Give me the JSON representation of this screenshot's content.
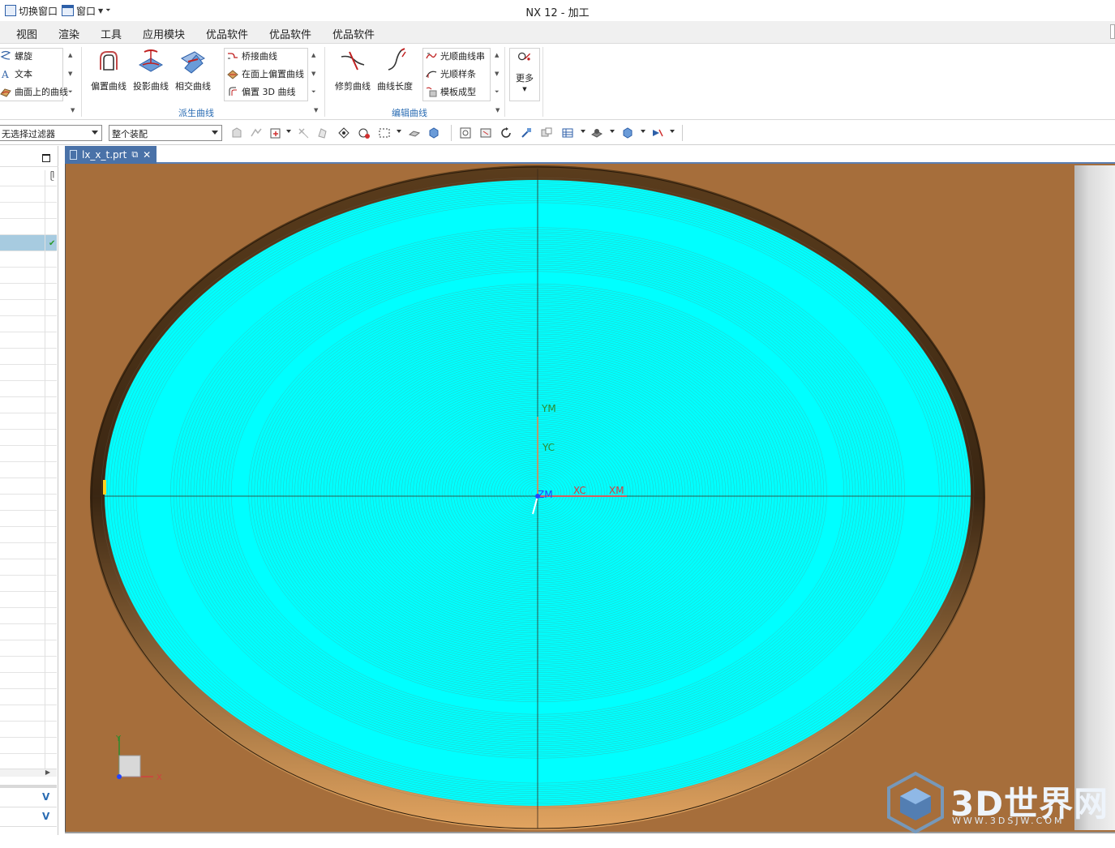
{
  "titlebar": {
    "switch_window_label": "切换窗口",
    "window_menu_label": "窗口",
    "app_title": "NX 12 - 加工"
  },
  "menu": {
    "items": [
      "视图",
      "渲染",
      "工具",
      "应用模块",
      "优品软件",
      "优品软件",
      "优品软件"
    ]
  },
  "ribbon": {
    "curve_list": [
      "螺旋",
      "文本",
      "曲面上的曲线"
    ],
    "derived": {
      "big_buttons": [
        "偏置曲线",
        "投影曲线",
        "相交曲线"
      ],
      "list": [
        "桥接曲线",
        "在面上偏置曲线",
        "偏置 3D 曲线"
      ],
      "group_label": "派生曲线"
    },
    "edit": {
      "big_buttons": [
        "修剪曲线",
        "曲线长度"
      ],
      "list": [
        "光顺曲线串",
        "光顺样条",
        "模板成型"
      ],
      "group_label": "编辑曲线"
    },
    "more_label": "更多"
  },
  "filterbar": {
    "type_filter": "无选择过滤器",
    "scope_filter": "整个装配"
  },
  "document_tab": {
    "name": "lx_x_t.prt"
  },
  "viewport": {
    "background_color": "#a66e3b",
    "toolpath_color": "#00ffff",
    "axis_labels": {
      "ym": "YM",
      "yc": "YC",
      "zm": "ZM",
      "xc": "XC",
      "xm": "XM",
      "triad_x": "X",
      "triad_y": "Y"
    }
  },
  "watermark": {
    "brand": "3D世界网",
    "url": "WWW.3DSJW.COM"
  }
}
